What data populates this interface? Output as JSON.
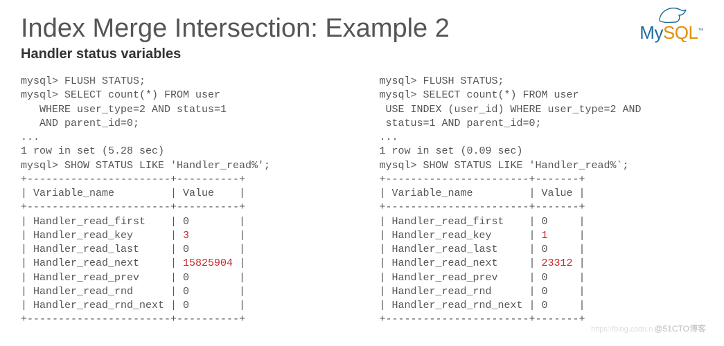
{
  "title": "Index Merge Intersection: Example 2",
  "subtitle": "Handler status variables",
  "logo": {
    "my": "My",
    "sql": "SQL",
    "tm": "™"
  },
  "left": {
    "q1": "mysql> FLUSH STATUS;",
    "q2": "mysql> SELECT count(*) FROM user",
    "q3": "   WHERE user_type=2 AND status=1",
    "q4": "   AND parent_id=0;",
    "dots1": "...",
    "rowinfo": "1 row in set (5.28 sec)",
    "show": "mysql> SHOW STATUS LIKE 'Handler_read%';",
    "border_top": "+-----------------------+----------+",
    "header": "| Variable_name         | Value    |",
    "border_mid": "+-----------------------+----------+",
    "rows": [
      {
        "name": "| Handler_read_first    | ",
        "val": "0",
        "pad": "        |",
        "hl": false
      },
      {
        "name": "| Handler_read_key      | ",
        "val": "3",
        "pad": "        |",
        "hl": true
      },
      {
        "name": "| Handler_read_last     | ",
        "val": "0",
        "pad": "        |",
        "hl": false
      },
      {
        "name": "| Handler_read_next     | ",
        "val": "15825904",
        "pad": " |",
        "hl": true
      },
      {
        "name": "| Handler_read_prev     | ",
        "val": "0",
        "pad": "        |",
        "hl": false
      },
      {
        "name": "| Handler_read_rnd      | ",
        "val": "0",
        "pad": "        |",
        "hl": false
      },
      {
        "name": "| Handler_read_rnd_next | ",
        "val": "0",
        "pad": "        |",
        "hl": false
      }
    ],
    "border_bot": "+-----------------------+----------+"
  },
  "right": {
    "q1": "mysql> FLUSH STATUS;",
    "q2": "mysql> SELECT count(*) FROM user",
    "q3": " USE INDEX (user_id) WHERE user_type=2 AND",
    "q4": " status=1 AND parent_id=0;",
    "dots1": "...",
    "rowinfo": "1 row in set (0.09 sec)",
    "show": "mysql> SHOW STATUS LIKE 'Handler_read%`;",
    "border_top": "+-----------------------+-------+",
    "header": "| Variable_name         | Value |",
    "border_mid": "+-----------------------+-------+",
    "rows": [
      {
        "name": "| Handler_read_first    | ",
        "val": "0",
        "pad": "     |",
        "hl": false
      },
      {
        "name": "| Handler_read_key      | ",
        "val": "1",
        "pad": "     |",
        "hl": true
      },
      {
        "name": "| Handler_read_last     | ",
        "val": "0",
        "pad": "     |",
        "hl": false
      },
      {
        "name": "| Handler_read_next     | ",
        "val": "23312",
        "pad": " |",
        "hl": true
      },
      {
        "name": "| Handler_read_prev     | ",
        "val": "0",
        "pad": "     |",
        "hl": false
      },
      {
        "name": "| Handler_read_rnd      | ",
        "val": "0",
        "pad": "     |",
        "hl": false
      },
      {
        "name": "| Handler_read_rnd_next | ",
        "val": "0",
        "pad": "     |",
        "hl": false
      }
    ],
    "border_bot": "+-----------------------+-------+"
  },
  "watermark": {
    "csdn": "https://blog.csdn.n",
    "cto": "@51CTO博客"
  }
}
